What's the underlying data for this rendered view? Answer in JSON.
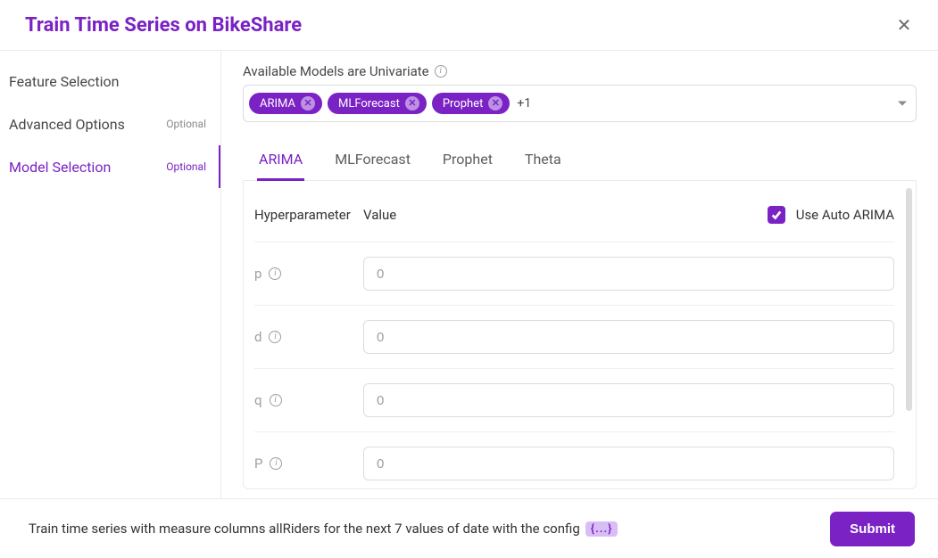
{
  "header": {
    "title": "Train Time Series on BikeShare"
  },
  "sidebar": {
    "items": [
      {
        "label": "Feature Selection",
        "optional": ""
      },
      {
        "label": "Advanced Options",
        "optional": "Optional"
      },
      {
        "label": "Model Selection",
        "optional": "Optional"
      }
    ]
  },
  "models": {
    "available_label": "Available Models are Univariate",
    "chips": [
      "ARIMA",
      "MLForecast",
      "Prophet"
    ],
    "overflow": "+1"
  },
  "tabs": [
    "ARIMA",
    "MLForecast",
    "Prophet",
    "Theta"
  ],
  "panel": {
    "col_hyper": "Hyperparameter",
    "col_value": "Value",
    "auto_label": "Use Auto ARIMA",
    "auto_checked": true,
    "params": [
      {
        "name": "p",
        "placeholder": "0"
      },
      {
        "name": "d",
        "placeholder": "0"
      },
      {
        "name": "q",
        "placeholder": "0"
      },
      {
        "name": "P",
        "placeholder": "0"
      }
    ]
  },
  "footer": {
    "text": "Train time series with measure columns allRiders for the next 7 values of date with the config",
    "config_badge": "{...}",
    "submit": "Submit"
  }
}
